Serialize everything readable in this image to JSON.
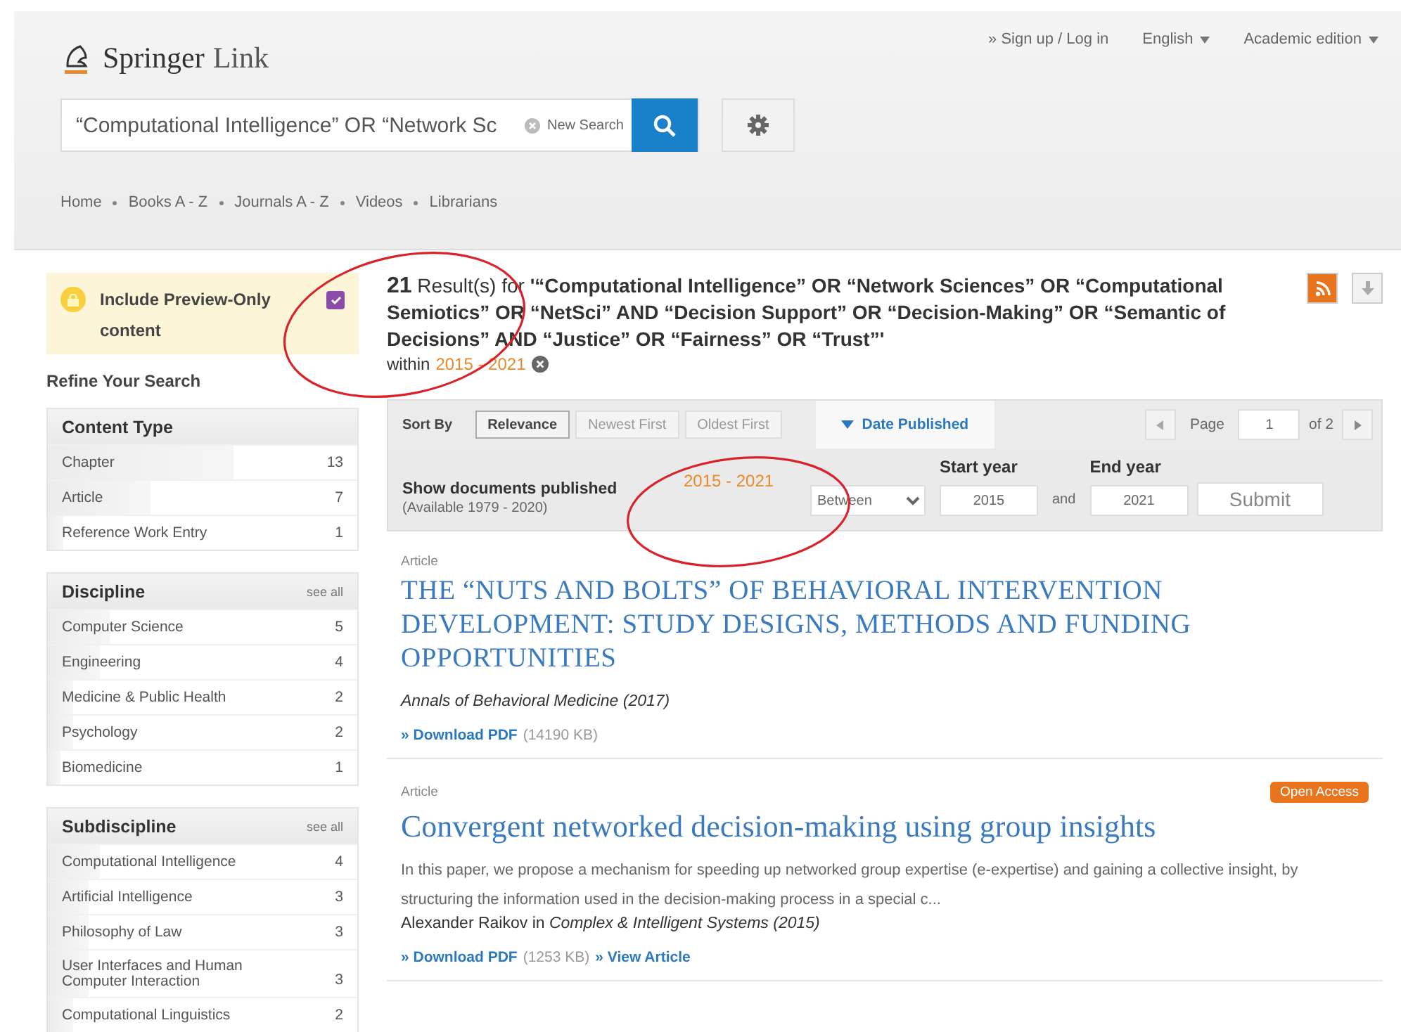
{
  "header": {
    "logo": {
      "word1": "Springer",
      "word2": "Link"
    },
    "account_link": "» Sign up / Log in",
    "language": "English",
    "edition": "Academic edition",
    "search": {
      "value": "“Computational Intelligence” OR “Network Sc",
      "clear": "New Search"
    },
    "nav": [
      "Home",
      "Books A - Z",
      "Journals A - Z",
      "Videos",
      "Librarians"
    ]
  },
  "sidebar": {
    "preview": {
      "label": "Include Preview-Only content",
      "checked": true
    },
    "refine_title": "Refine Your Search",
    "facets": [
      {
        "title": "Content Type",
        "items": [
          {
            "label": "Chapter",
            "count": "13",
            "level": 0.6
          },
          {
            "label": "Article",
            "count": "7",
            "level": 0.33
          },
          {
            "label": "Reference Work Entry",
            "count": "1",
            "level": 0.05
          }
        ]
      },
      {
        "title": "Discipline",
        "see_all": "see all",
        "items": [
          {
            "label": "Computer Science",
            "count": "5",
            "level": 0.2
          },
          {
            "label": "Engineering",
            "count": "4",
            "level": 0.17
          },
          {
            "label": "Medicine & Public Health",
            "count": "2",
            "level": 0.08
          },
          {
            "label": "Psychology",
            "count": "2",
            "level": 0.08
          },
          {
            "label": "Biomedicine",
            "count": "1",
            "level": 0.04
          }
        ]
      },
      {
        "title": "Subdiscipline",
        "see_all": "see all",
        "items": [
          {
            "label": "Computational Intelligence",
            "count": "4",
            "level": 0.17
          },
          {
            "label": "Artificial Intelligence",
            "count": "3",
            "level": 0.13
          },
          {
            "label": "Philosophy of Law",
            "count": "3",
            "level": 0.13
          },
          {
            "label": "User Interfaces and Human Computer Interaction",
            "count": "3",
            "level": 0.13
          },
          {
            "label": "Computational Linguistics",
            "count": "2",
            "level": 0.08
          }
        ]
      }
    ]
  },
  "results_header": {
    "title": "**21** Result(s) for **'“Computational Intelligence” OR “Network Sciences” OR “Computational Semiotics” OR “NetSci” AND “Decision Support” OR “Decision-Making” OR “Semantic of Decisions” AND “Justice” OR “Fairness” OR “Trust”'**",
    "within": "within",
    "range": "2015 - 2021"
  },
  "sort": {
    "label": "Sort By",
    "options": [
      {
        "label": "Relevance",
        "selected": true
      },
      {
        "label": "Newest First",
        "selected": false
      },
      {
        "label": "Oldest First",
        "selected": false
      }
    ],
    "date_tab": {
      "label": "Date Published",
      "expanded": true
    },
    "page_label": "Page",
    "page": "1",
    "of": "of 2"
  },
  "date_filter": {
    "title": "Show documents published",
    "available": "(Available 1979 - 2020)",
    "range": "2015 - 2021",
    "mode": "Between",
    "start_label": "Start year",
    "end_label": "End year",
    "start": "2015",
    "and": "and",
    "end": "2021",
    "submit": "Submit"
  },
  "results": [
    {
      "type": "Article",
      "title": "THE “NUTS AND BOLTS” OF BEHAVIORAL INTERVENTION DEVELOPMENT: STUDY DESIGNS, METHODS AND FUNDING OPPORTUNITIES",
      "source": "*Annals of Behavioral Medicine (2017)*",
      "download": "» Download PDF",
      "size": "(14190 KB)"
    },
    {
      "type": "Article",
      "badge": "Open Access",
      "title": "Convergent networked decision-making using group insights",
      "snippet": "In this paper, we propose a mechanism for speeding up networked group expertise (e-expertise) and gaining a collective insight, by structuring the information used in the decision-making process in a special c...",
      "source": "Alexander Raikov in *Complex & Intelligent Systems (2015)*",
      "download": "» Download PDF",
      "size": "(1253 KB)",
      "view": "» View Article"
    }
  ],
  "annotations": [
    {
      "kind": "ellipse"
    },
    {
      "kind": "ellipse"
    }
  ]
}
